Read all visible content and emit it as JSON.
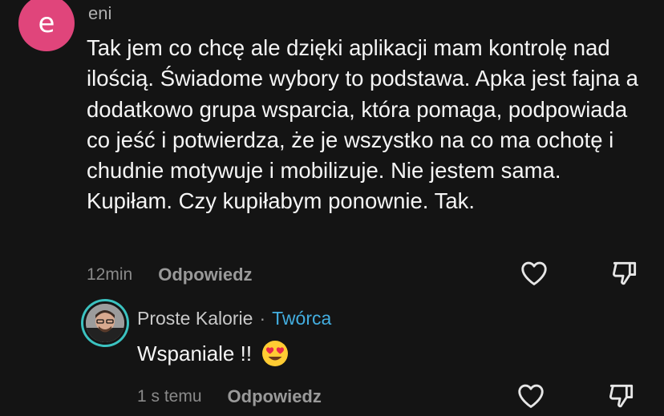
{
  "comment": {
    "avatar_letter": "e",
    "avatar_color": "#e0457b",
    "username": "eni",
    "text": "Tak jem co chcę ale dzięki aplikacji mam kontrolę nad ilością. Świadome wybory to podstawa. Apka jest fajna a dodatkowo grupa wsparcia, która pomaga, podpowiada co jeść i potwierdza, że je wszystko na co ma ochotę i chudnie motywuje i mobilizuje. Nie jestem sama. Kupiłam. Czy kupiłabym ponownie. Tak.",
    "time": "12min",
    "reply_label": "Odpowiedz",
    "like_icon": "heart-icon",
    "dislike_icon": "thumb-down-icon"
  },
  "reply": {
    "author": "Proste Kalorie",
    "separator": "·",
    "badge": "Twórca",
    "badge_color": "#43aee0",
    "ring_color": "#3bc2c0",
    "text": "Wspaniale !!",
    "emoji": "heart-eyes-emoji",
    "time": "1 s temu",
    "reply_label": "Odpowiedz"
  }
}
